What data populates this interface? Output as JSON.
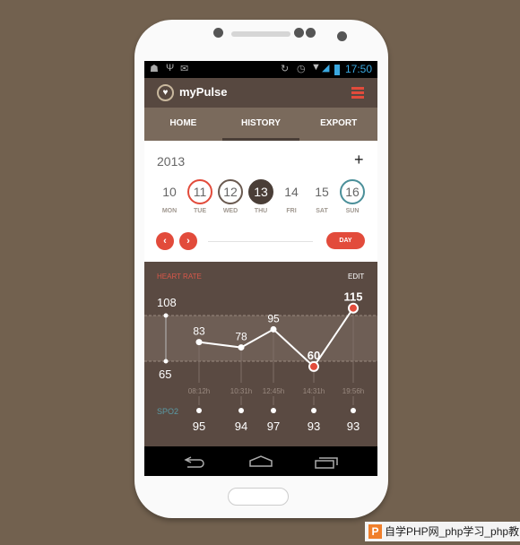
{
  "status_bar": {
    "time": "17:50",
    "icons_left": [
      "android-icon",
      "usb-icon",
      "gmail-icon"
    ],
    "icons_right": [
      "sync-icon",
      "alarm-icon",
      "wifi-icon",
      "signal-icon",
      "battery-icon"
    ]
  },
  "app_bar": {
    "title": "myPulse",
    "logo_icon": "heart-icon",
    "menu_icon": "hamburger-menu-icon",
    "accent": "#e24b3b"
  },
  "tabs": [
    {
      "label": "HOME"
    },
    {
      "label": "HISTORY",
      "active": true
    },
    {
      "label": "EXPORT"
    }
  ],
  "calendar": {
    "year": "2013",
    "add_label": "+",
    "days": [
      {
        "num": "10",
        "day": "MON",
        "style": "plain"
      },
      {
        "num": "11",
        "day": "TUE",
        "style": "red-ring"
      },
      {
        "num": "12",
        "day": "WED",
        "style": "brown-ring"
      },
      {
        "num": "13",
        "day": "THU",
        "style": "selected"
      },
      {
        "num": "14",
        "day": "FRI",
        "style": "plain"
      },
      {
        "num": "15",
        "day": "SAT",
        "style": "plain"
      },
      {
        "num": "16",
        "day": "SUN",
        "style": "teal-ring"
      }
    ],
    "prev_label": "‹",
    "next_label": "›",
    "range_label": "DAY"
  },
  "chart": {
    "title": "HEART RATE",
    "edit_label": "EDIT",
    "range_high": 108,
    "range_low": 65,
    "range_high_label": "108",
    "range_low_label": "65",
    "times": [
      "08:12h",
      "10:31h",
      "12:45h",
      "14:31h",
      "19:56h"
    ],
    "heart_rate": [
      83,
      78,
      95,
      60,
      115
    ],
    "heart_rate_labels": [
      "83",
      "78",
      "95",
      "60",
      "115"
    ],
    "spo2_label": "SPO2",
    "spo2": [
      "95",
      "94",
      "97",
      "93",
      "93"
    ]
  },
  "nav_bar": {
    "icons": [
      "back-icon",
      "home-icon",
      "recents-icon"
    ]
  },
  "watermark": {
    "text": "自学PHP网_php学习_php教",
    "logo": "P"
  }
}
